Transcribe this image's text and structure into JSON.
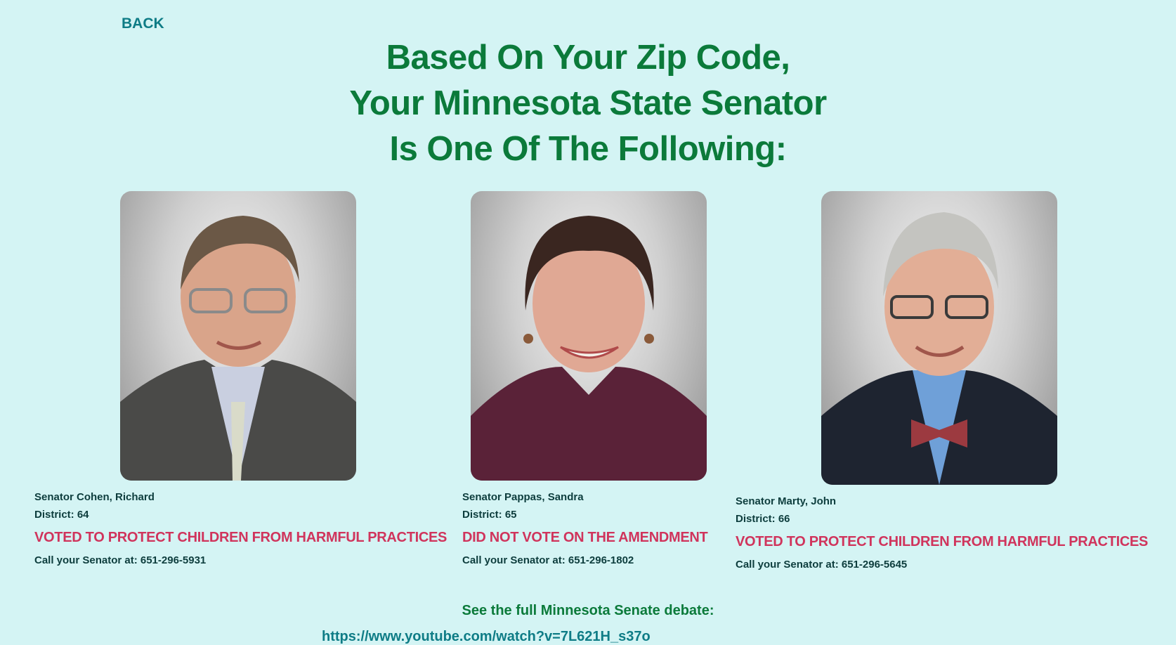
{
  "nav": {
    "back_label": "BACK"
  },
  "headline": {
    "line1": "Based On Your Zip Code,",
    "line2": "Your Minnesota State Senator",
    "line3": "Is One Of The Following:"
  },
  "senators": [
    {
      "name": "Senator Cohen, Richard",
      "district": "District: 64",
      "vote": "VOTED TO PROTECT CHILDREN FROM HARMFUL PRACTICES",
      "phone": "Call your Senator at: 651-296-5931",
      "photo_icon": "senator-portrait"
    },
    {
      "name": "Senator Pappas, Sandra",
      "district": "District: 65",
      "vote": "DID NOT VOTE ON THE AMENDMENT",
      "phone": "Call your Senator at: 651-296-1802",
      "photo_icon": "senator-portrait"
    },
    {
      "name": "Senator Marty, John",
      "district": "District: 66",
      "vote": "VOTED TO PROTECT CHILDREN FROM HARMFUL PRACTICES",
      "phone": "Call your Senator at: 651-296-5645",
      "photo_icon": "senator-portrait"
    }
  ],
  "debate": {
    "label": "See the full Minnesota Senate debate:",
    "url": "https://www.youtube.com/watch?v=7L621H_s37o"
  },
  "colors": {
    "background": "#d4f4f4",
    "headline": "#0b7a3a",
    "link": "#0e7c86",
    "vote": "#d0345c",
    "text": "#0d3d3d"
  }
}
